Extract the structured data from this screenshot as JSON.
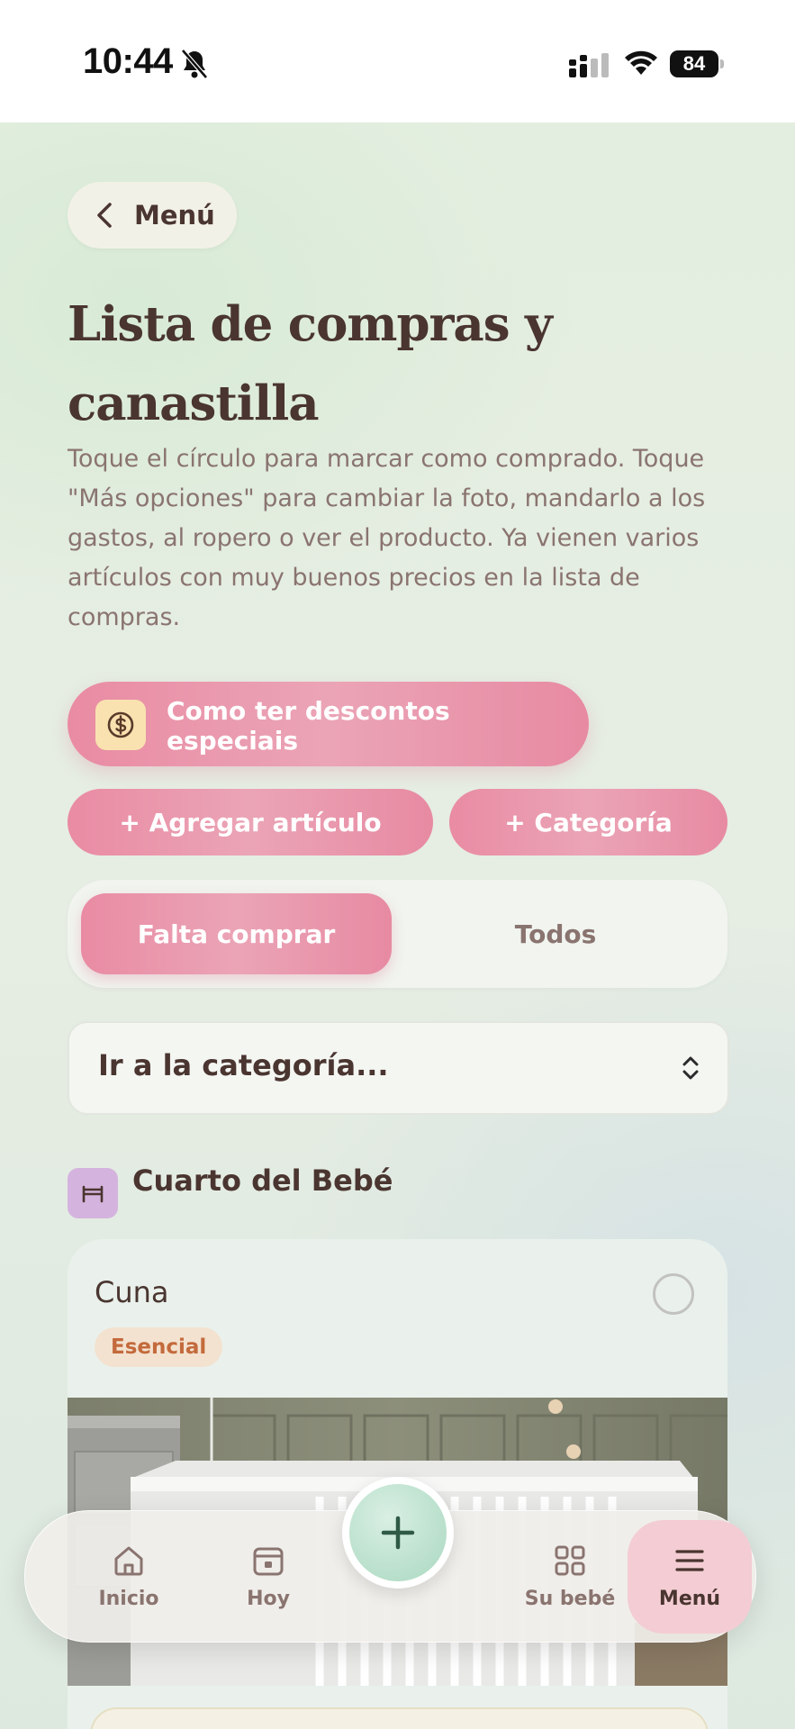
{
  "status_bar": {
    "time": "10:44",
    "battery": "84",
    "icons": [
      "bell-slash-icon",
      "signal-icon",
      "wifi-icon",
      "battery-icon"
    ]
  },
  "header": {
    "back_label": "Menú",
    "title": "Lista de compras y canastilla",
    "description": "Toque el círculo para marcar como comprado. Toque \"Más opciones\" para cambiar la foto, mandarlo a los gastos, al ropero o ver el producto. Ya vienen varios artículos con muy buenos precios en la lista de compras."
  },
  "actions": {
    "promo_label": "Como ter descontos especiais",
    "add_item_label": "+ Agregar artículo",
    "add_category_label": "+ Categoría"
  },
  "filter": {
    "options": [
      "Falta comprar",
      "Todos"
    ],
    "selected": "Falta comprar"
  },
  "category_select": {
    "value": "Ir a la categoría..."
  },
  "category": {
    "title": "Cuarto del Bebé",
    "items": [
      {
        "name": "Cuna",
        "badge": "Esencial",
        "checked": false
      }
    ]
  },
  "tab_bar": {
    "tabs": [
      {
        "label": "Inicio",
        "icon": "home-icon"
      },
      {
        "label": "Hoy",
        "icon": "calendar-icon"
      },
      {
        "label": "Su bebé",
        "icon": "grid-icon"
      },
      {
        "label": "Menú",
        "icon": "menu-icon"
      }
    ],
    "active": "Menú",
    "fab_icon": "plus-icon"
  },
  "colors": {
    "accent_pink": "#e98ba3",
    "text_dark": "#4a3530",
    "text_muted": "#8a7470",
    "badge_bg": "#f3e2cf",
    "badge_text": "#c46a3c",
    "fab_green": "#a9d8c0"
  }
}
